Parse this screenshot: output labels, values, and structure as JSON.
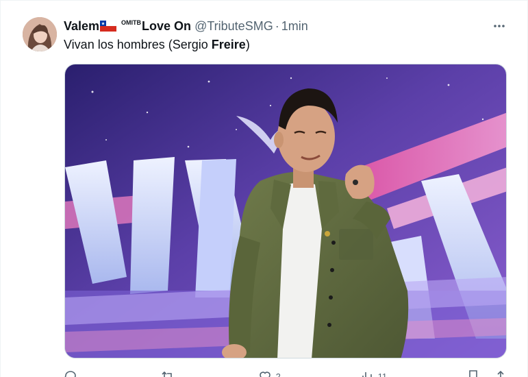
{
  "tweet": {
    "display_name": "Valem",
    "name_badge_text": "OMITB",
    "name_suffix": "Love On",
    "handle": "@TributeSMG",
    "separator": "·",
    "time": "1min",
    "more_label": "···",
    "text_before": "Vivan los hombres (Sergio ",
    "text_bold": "Freire",
    "text_after": ")"
  },
  "flag": {
    "name": "chile-flag-icon",
    "colors": {
      "red": "#d52b1e",
      "blue": "#0039a6",
      "white": "#ffffff"
    }
  },
  "actions": {
    "reply_count": "",
    "retweet_count": "",
    "like_count": "2",
    "views_count": "11"
  },
  "icons": [
    "reply-icon",
    "retweet-icon",
    "heart-icon",
    "views-icon",
    "bookmark-icon",
    "share-icon",
    "more-icon"
  ],
  "colors": {
    "secondary_text": "#536471",
    "primary_text": "#0f1419",
    "border": "#cfd9de"
  }
}
